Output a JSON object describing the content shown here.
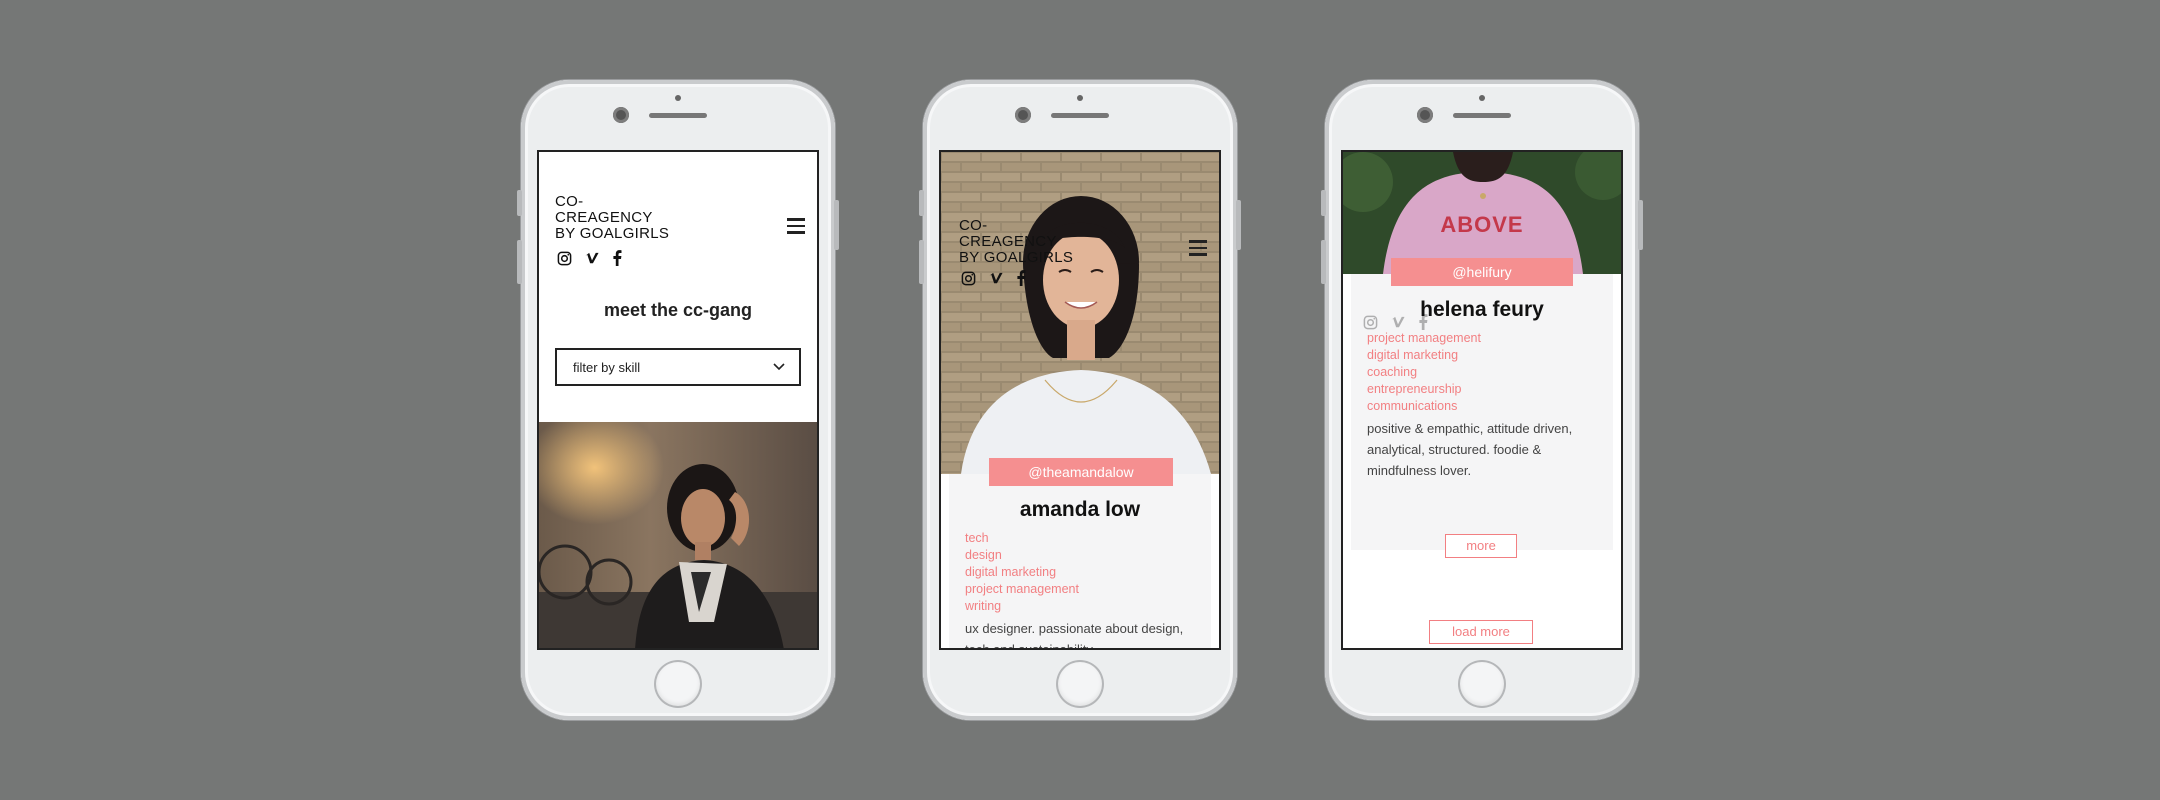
{
  "brand": {
    "line1": "CO-",
    "line2": "CREAGENCY",
    "line3": "BY GOALGIRLS"
  },
  "icons": {
    "menu": "hamburger-menu-icon",
    "instagram": "instagram-icon",
    "vimeo": "vimeo-icon",
    "facebook": "facebook-icon",
    "chevron": "chevron-down-icon"
  },
  "colors": {
    "accent": "#f58f90",
    "background": "#757776"
  },
  "phone1": {
    "heading": "meet the cc-gang",
    "filter_label": "filter by skill"
  },
  "phone2": {
    "handle": "@theamandalow",
    "name": "amanda low",
    "skills": [
      "tech",
      "design",
      "digital marketing",
      "project management",
      "writing"
    ],
    "bio": "ux designer. passionate about design, tech and sustainability."
  },
  "phone3": {
    "shirt_text": "ABOVE",
    "handle": "@helifury",
    "name": "helena feury",
    "skills": [
      "project management",
      "digital marketing",
      "coaching",
      "entrepreneurship",
      "communications"
    ],
    "bio": "positive & empathic, attitude driven, analytical, structured. foodie & mindfulness lover.",
    "more_label": "more",
    "load_more_label": "load more"
  }
}
